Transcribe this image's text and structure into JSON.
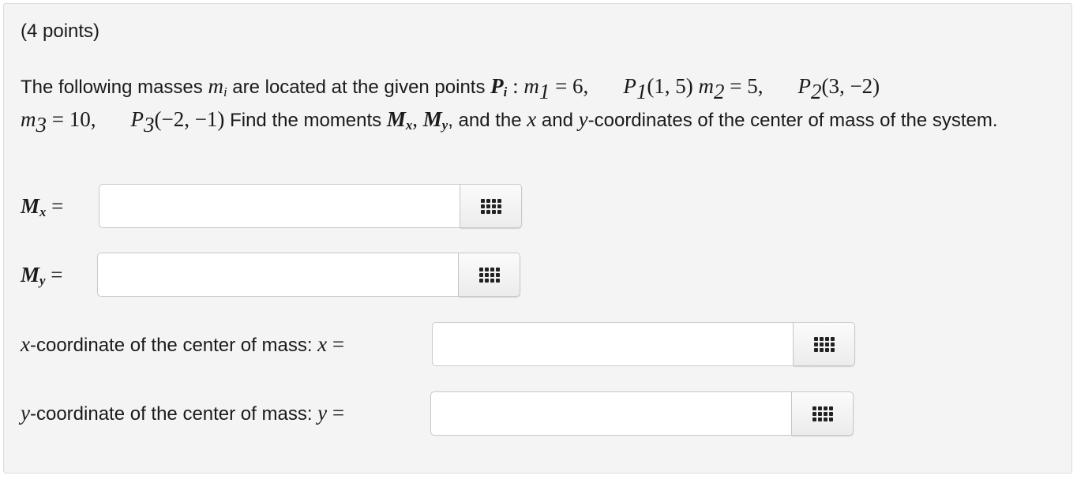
{
  "points_label": "(4 points)",
  "problem": {
    "intro": "The following masses ",
    "m_i": "m",
    "i_sub": "i",
    "located": " are located at the given points ",
    "P_i": "P",
    "colon": " : ",
    "m1": "m",
    "m1_sub": "1",
    "m1_val": " = 6,",
    "P1": "P",
    "P1_sub": "1",
    "P1_coords": "(1, 5)",
    "m2": "m",
    "m2_sub": "2",
    "m2_val": " = 5,",
    "P2": "P",
    "P2_sub": "2",
    "P2_coords": "(3, −2)",
    "m3": "m",
    "m3_sub": "3",
    "m3_val": " = 10,",
    "P3": "P",
    "P3_sub": "3",
    "P3_coords": "(−2, −1)",
    "find": " Find the moments ",
    "Mx": "M",
    "Mx_sub": "x",
    "comma": ", ",
    "My": "M",
    "My_sub": "y",
    "and_the": ", and the ",
    "x": "x",
    "and": " and ",
    "y": "y",
    "rest": "-coordinates of the center of mass of the system."
  },
  "answers": [
    {
      "label_math": "M",
      "label_sub": "x",
      "label_eq": " =",
      "value": "",
      "keypad": "keypad-icon"
    },
    {
      "label_math": "M",
      "label_sub": "y",
      "label_eq": " =",
      "value": "",
      "keypad": "keypad-icon"
    },
    {
      "label_text": "-coordinate of the center of mass: ",
      "label_var": "x",
      "label_eq": " =",
      "prefix_var": "x",
      "value": "",
      "keypad": "keypad-icon"
    },
    {
      "label_text": "-coordinate of the center of mass: ",
      "label_var": "y",
      "label_eq": " =",
      "prefix_var": "y",
      "value": "",
      "keypad": "keypad-icon"
    }
  ],
  "colors": {
    "card_bg": "#f4f4f4",
    "border": "#c9c9c9",
    "keypad_dot": "#222222"
  }
}
